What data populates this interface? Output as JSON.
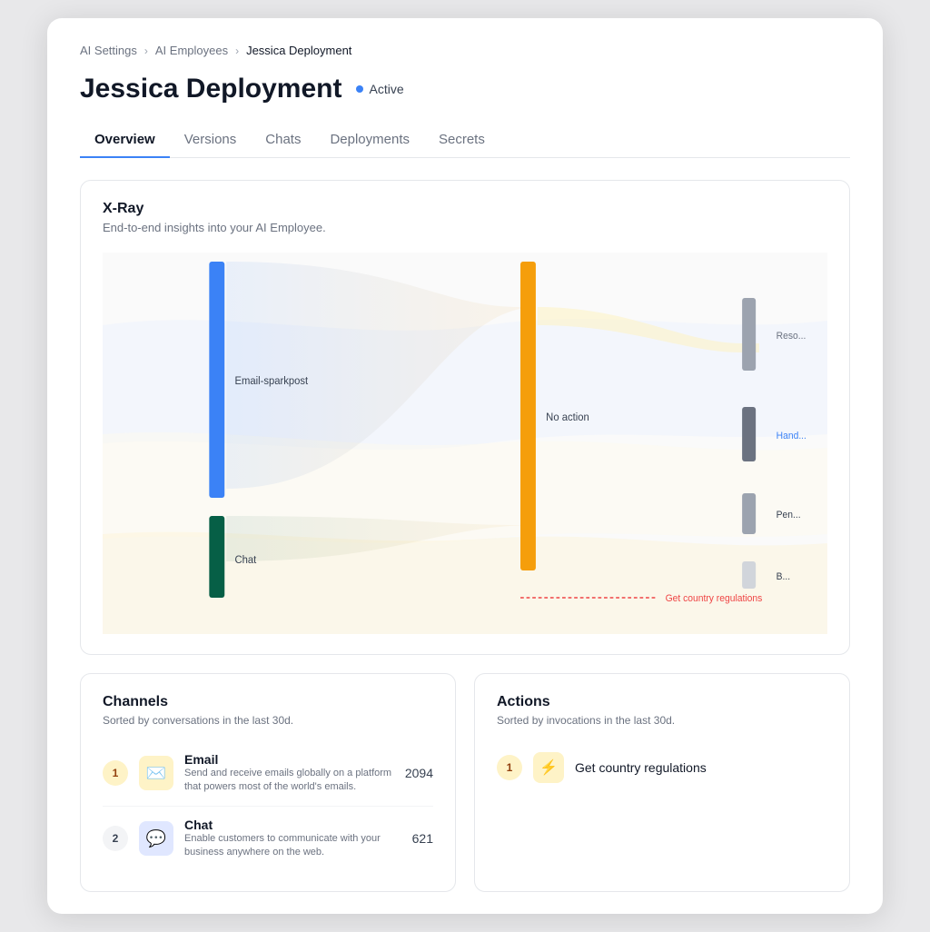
{
  "breadcrumb": {
    "items": [
      "AI Settings",
      "AI Employees",
      "Jessica Deployment"
    ]
  },
  "page": {
    "title": "Jessica Deployment",
    "status": "Active"
  },
  "tabs": [
    {
      "label": "Overview",
      "active": true
    },
    {
      "label": "Versions",
      "active": false
    },
    {
      "label": "Chats",
      "active": false
    },
    {
      "label": "Deployments",
      "active": false
    },
    {
      "label": "Secrets",
      "active": false
    }
  ],
  "xray": {
    "title": "X-Ray",
    "subtitle": "End-to-end insights into your AI Employee.",
    "nodes": {
      "email": "Email-sparkpost",
      "chat": "Chat",
      "no_action": "No action",
      "resolution": "Reso...",
      "handoff": "Hand...",
      "pending": "Pen...",
      "b": "B..."
    }
  },
  "channels": {
    "title": "Channels",
    "subtitle": "Sorted by conversations in the last 30d.",
    "items": [
      {
        "rank": "1",
        "rank_style": "gold",
        "name": "Email",
        "desc": "Send and receive emails globally on a platform that powers most of the world's emails.",
        "count": "2094",
        "icon": "✉"
      },
      {
        "rank": "2",
        "rank_style": "silver",
        "name": "Chat",
        "desc": "Enable customers to communicate with your business anywhere on the web.",
        "count": "621",
        "icon": "💬"
      }
    ]
  },
  "actions": {
    "title": "Actions",
    "subtitle": "Sorted by invocations in the last 30d.",
    "items": [
      {
        "rank": "1",
        "rank_style": "gold",
        "name": "Get country regulations",
        "icon": "⚡"
      }
    ]
  }
}
